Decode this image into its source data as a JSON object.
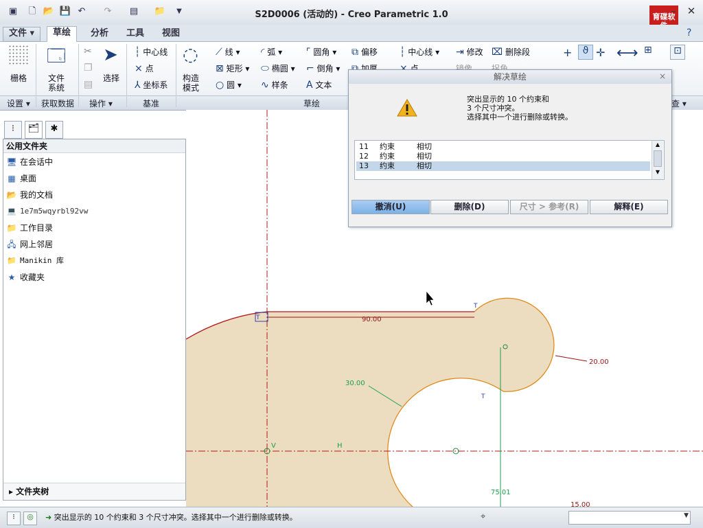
{
  "window": {
    "title": "S2D0006 (活动的) - Creo Parametric 1.0",
    "minimize": "–",
    "close": "✕",
    "logo_text": "育碟软件"
  },
  "menu_tabs": [
    "文件",
    "草绘",
    "分析",
    "工具",
    "视图"
  ],
  "active_tab": "草绘",
  "ribbon": {
    "grid": "栅格",
    "file_system_1": "文件",
    "file_system_2": "系统",
    "select": "选择",
    "centerline": "中心线",
    "point": "点",
    "coord_sys": "坐标系",
    "construct_1": "构造",
    "construct_2": "模式",
    "line": "线",
    "arc": "弧",
    "fillet": "圆角",
    "offset": "偏移",
    "rectangle": "矩形",
    "ellipse": "椭圆",
    "chamfer": "倒角",
    "thicken": "加厚",
    "circle": "圆",
    "spline": "样条",
    "text": "文本",
    "centerline2": "中心线",
    "point2": "点",
    "modify": "修改",
    "delete_segment": "删除段",
    "mirror": "镜像",
    "split": "拐角"
  },
  "groups": {
    "setup": "设置",
    "get_data": "获取数据",
    "operations": "操作",
    "datum": "基准",
    "sketch": "草绘",
    "inspect": "查"
  },
  "left_panel": {
    "header": "公用文件夹",
    "items": [
      {
        "label": "在会话中",
        "icon": "monitor-icon"
      },
      {
        "label": "桌面",
        "icon": "desktop-icon"
      },
      {
        "label": "我的文档",
        "icon": "documents-icon"
      },
      {
        "label": "1e7m5wqyrbl92vw",
        "icon": "computer-icon"
      },
      {
        "label": "工作目录",
        "icon": "folder-icon"
      },
      {
        "label": "网上邻居",
        "icon": "network-icon"
      },
      {
        "label": "Manikin 库",
        "icon": "folder-icon"
      },
      {
        "label": "收藏夹",
        "icon": "favorites-icon"
      }
    ],
    "tree": "文件夹树"
  },
  "dialog": {
    "title": "解决草绘",
    "message_1": "突出显示的 10 个约束和",
    "message_2": "3 个尺寸冲突。",
    "message_3": "选择其中一个进行删除或转换。",
    "rows": [
      {
        "num": "11",
        "type": "约束",
        "desc": "相切",
        "selected": false
      },
      {
        "num": "12",
        "type": "约束",
        "desc": "相切",
        "selected": false
      },
      {
        "num": "13",
        "type": "约束",
        "desc": "相切",
        "selected": true
      }
    ],
    "buttons": {
      "undo": "撤消(U)",
      "delete": "删除(D)",
      "dim_ref": "尺寸 > 参考(R)",
      "explain": "解释(E)"
    }
  },
  "sketch": {
    "dim_90": "90.00",
    "dim_20": "20.00",
    "dim_30": "30.00",
    "dim_75": "75.01",
    "dim_15": "15.00",
    "label_T1": "T",
    "label_T2": "T",
    "label_T3": "T",
    "label_V": "V",
    "label_H": "H",
    "fill_color": "#ecdcc0",
    "edge_color": "#e08a1e",
    "dim_color": "#9a1414",
    "weak_dim_color": "#1aa14a"
  },
  "status": {
    "message": "突出显示的 10 个约束和 3 个尺寸冲突。选择其中一个进行删除或转换。"
  }
}
